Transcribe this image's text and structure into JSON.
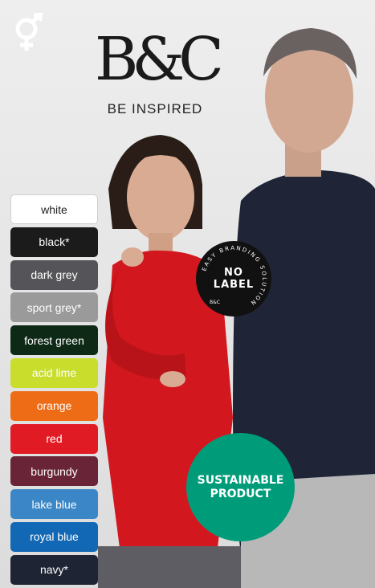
{
  "brand": {
    "logo": "B&C",
    "tagline": "BE INSPIRED"
  },
  "icon_gender": "unisex-icon",
  "swatches": [
    {
      "label": "white",
      "bg": "#ffffff",
      "fg": "#222222"
    },
    {
      "label": "black*",
      "bg": "#1b1b1b",
      "fg": "#ffffff"
    },
    {
      "label": "dark grey",
      "bg": "#555559",
      "fg": "#ffffff"
    },
    {
      "label": "sport grey*",
      "bg": "#9a9a9a",
      "fg": "#ffffff"
    },
    {
      "label": "forest green",
      "bg": "#0e2a17",
      "fg": "#ffffff"
    },
    {
      "label": "acid lime",
      "bg": "#c9dd2c",
      "fg": "#ffffff"
    },
    {
      "label": "orange",
      "bg": "#ef6c16",
      "fg": "#ffffff"
    },
    {
      "label": "red",
      "bg": "#e01b24",
      "fg": "#ffffff"
    },
    {
      "label": "burgundy",
      "bg": "#6a2437",
      "fg": "#ffffff"
    },
    {
      "label": "lake blue",
      "bg": "#3b86c6",
      "fg": "#ffffff"
    },
    {
      "label": "royal blue",
      "bg": "#1268b4",
      "fg": "#ffffff"
    },
    {
      "label": "navy*",
      "bg": "#1e2433",
      "fg": "#ffffff"
    }
  ],
  "badge_nolabel": {
    "arc_text": "EASY BRANDING SOLUTION",
    "brand_mark": "B&C",
    "line1": "NO",
    "line2": "LABEL"
  },
  "badge_sustainable": {
    "line1": "SUSTAINABLE",
    "line2": "PRODUCT",
    "color": "#009c7a"
  }
}
